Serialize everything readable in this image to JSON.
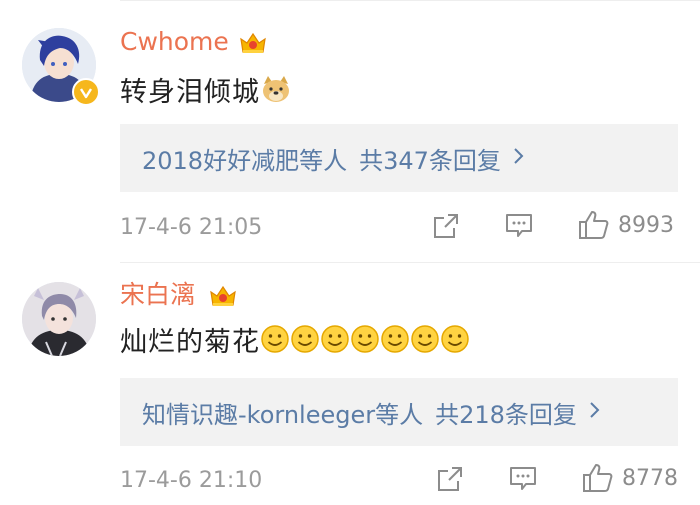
{
  "comments": [
    {
      "username": "Cwhome",
      "text": "转身泪倾城",
      "replies": {
        "users": "2018好好减肥等人",
        "count": "共347条回复"
      },
      "time": "17-4-6 21:05",
      "likes": "8993"
    },
    {
      "username": "宋白漓",
      "text": "灿烂的菊花",
      "replies": {
        "users": "知情识趣-kornleeger等人",
        "count": "共218条回复"
      },
      "time": "17-4-6 21:10",
      "likes": "8778"
    }
  ],
  "colors": {
    "username": "#eb7350",
    "link": "#5b7ca6",
    "timestamp": "#9b9b9b",
    "reply_bg": "#f2f2f2"
  },
  "icons": [
    "vip-crown-icon",
    "verified-badge-icon",
    "doge-emoji-icon",
    "smile-emoji-icon",
    "chevron-right-icon",
    "share-icon",
    "comment-icon",
    "thumbs-up-icon"
  ]
}
